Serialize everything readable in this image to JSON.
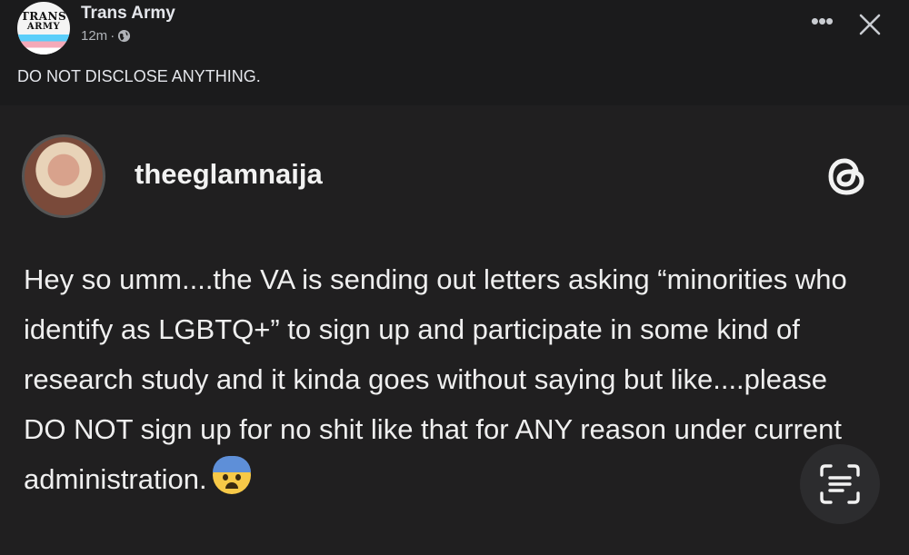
{
  "post": {
    "page_name": "Trans Army",
    "avatar_text": [
      "TRANS",
      "ARMY"
    ],
    "time": "12m",
    "separator": "·",
    "caption": "DO NOT DISCLOSE ANYTHING."
  },
  "header_actions": {
    "more_label": "•••",
    "more_icon": "more-icon",
    "close_icon": "close-icon"
  },
  "threads_post": {
    "username": "theeglamnaija",
    "logo_icon": "threads-logo-icon",
    "text": "Hey so umm....the VA is sending out letters asking “minorities who identify as LGBTQ+” to sign up and participate in some kind of research study and it kinda goes without saying but like....please DO NOT sign up for no shit like that for ANY reason under current administration.",
    "emoji": "anxious-face-with-sweat-emoji"
  },
  "overlay": {
    "scan_icon": "scan-text-icon"
  },
  "colors": {
    "background": "#1b1b1c",
    "screenshot_background": "#201f20",
    "primary_text": "#e4e6eb",
    "secondary_text": "#b0b3b8"
  }
}
